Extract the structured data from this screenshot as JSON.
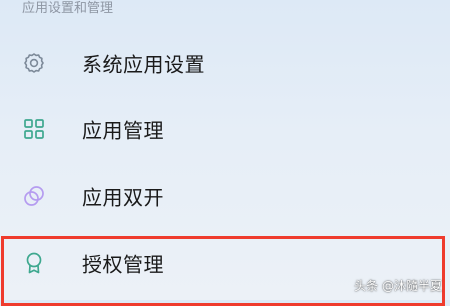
{
  "section": {
    "header": "应用设置和管理"
  },
  "menu": {
    "items": [
      {
        "label": "系统应用设置",
        "icon": "gear-icon",
        "icon_color": "#7d8a99"
      },
      {
        "label": "应用管理",
        "icon": "grid-apps-icon",
        "icon_color": "#3ea88f"
      },
      {
        "label": "应用双开",
        "icon": "dual-circle-icon",
        "icon_color": "#b59cf0"
      },
      {
        "label": "授权管理",
        "icon": "badge-icon",
        "icon_color": "#3ea88f"
      }
    ]
  },
  "highlight_color": "#ef3b2d",
  "watermark": "头条 @沐隨半夏"
}
